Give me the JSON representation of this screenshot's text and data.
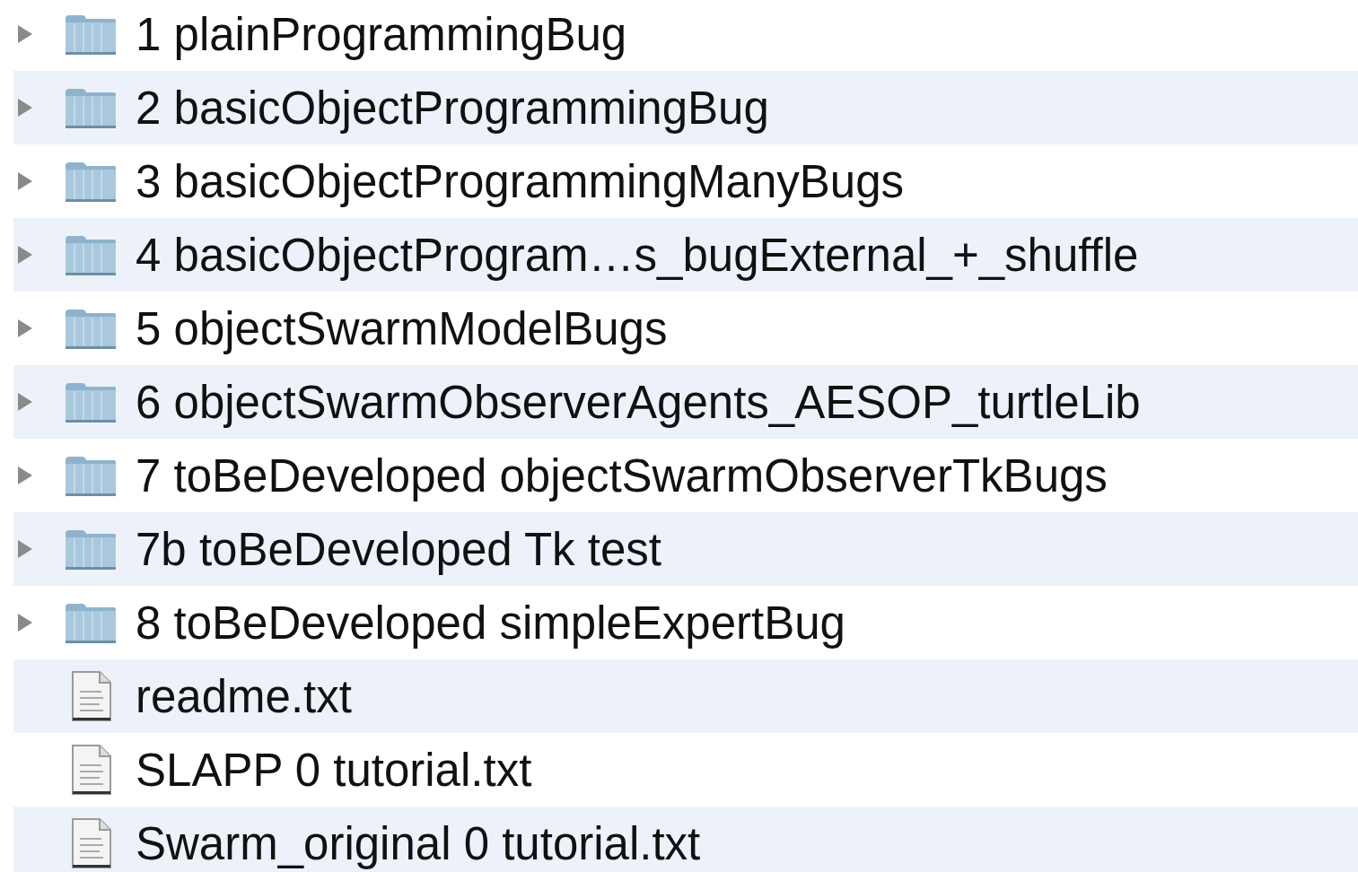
{
  "items": [
    {
      "kind": "folder",
      "expanded": false,
      "name": "1 plainProgrammingBug"
    },
    {
      "kind": "folder",
      "expanded": false,
      "name": "2 basicObjectProgrammingBug"
    },
    {
      "kind": "folder",
      "expanded": false,
      "name": "3 basicObjectProgrammingManyBugs"
    },
    {
      "kind": "folder",
      "expanded": false,
      "name": "4 basicObjectProgram…s_bugExternal_+_shuffle"
    },
    {
      "kind": "folder",
      "expanded": false,
      "name": "5 objectSwarmModelBugs"
    },
    {
      "kind": "folder",
      "expanded": false,
      "name": "6 objectSwarmObserverAgents_AESOP_turtleLib"
    },
    {
      "kind": "folder",
      "expanded": false,
      "name": "7 toBeDeveloped objectSwarmObserverTkBugs"
    },
    {
      "kind": "folder",
      "expanded": false,
      "name": "7b toBeDeveloped Tk test"
    },
    {
      "kind": "folder",
      "expanded": false,
      "name": "8 toBeDeveloped simpleExpertBug"
    },
    {
      "kind": "file",
      "name": "readme.txt"
    },
    {
      "kind": "file",
      "name": "SLAPP 0 tutorial.txt"
    },
    {
      "kind": "file",
      "name": "Swarm_original 0 tutorial.txt"
    }
  ]
}
